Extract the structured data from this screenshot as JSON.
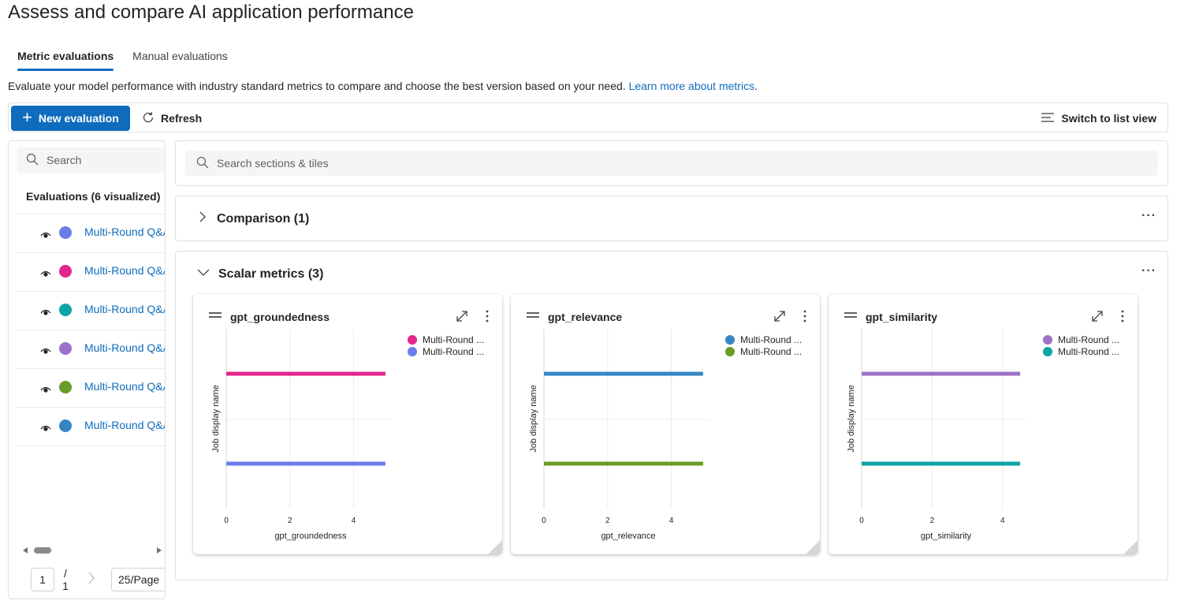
{
  "page": {
    "title": "Assess and compare AI application performance"
  },
  "tabs": [
    {
      "label": "Metric evaluations",
      "active": true
    },
    {
      "label": "Manual evaluations",
      "active": false
    }
  ],
  "description": {
    "text": "Evaluate your model performance with industry standard metrics to compare and choose the best version based on your need.",
    "link": "Learn more about metrics",
    "suffix": "."
  },
  "toolbar": {
    "new_label": "New evaluation",
    "refresh_label": "Refresh",
    "listview_label": "Switch to list view"
  },
  "left": {
    "search_placeholder": "Search",
    "heading": "Evaluations (6 visualized)",
    "items": [
      {
        "label": "Multi-Round Q&A",
        "color": "#6b7de8"
      },
      {
        "label": "Multi-Round Q&A",
        "color": "#e3258e"
      },
      {
        "label": "Multi-Round Q&A",
        "color": "#0ea3a5"
      },
      {
        "label": "Multi-Round Q&A",
        "color": "#9b72c8"
      },
      {
        "label": "Multi-Round Q&A",
        "color": "#6a9b26"
      },
      {
        "label": "Multi-Round Q&A",
        "color": "#3586c5"
      }
    ],
    "pager": {
      "page": "1",
      "of_slash": "/",
      "of_total": "1",
      "page_size": "25/Page"
    }
  },
  "right": {
    "search_placeholder": "Search sections & tiles",
    "sections": [
      {
        "title": "Comparison (1)",
        "expanded": false
      },
      {
        "title": "Scalar metrics (3)",
        "expanded": true
      }
    ]
  },
  "chart_data": [
    {
      "type": "bar",
      "orientation": "horizontal",
      "title": "gpt_groundedness",
      "xlabel": "gpt_groundedness",
      "ylabel": "Job display name",
      "xlim": [
        0,
        5.2
      ],
      "xticks": [
        0,
        2,
        4
      ],
      "grid": true,
      "legend_placement": "top-right",
      "series": [
        {
          "name": "Multi-Round ...",
          "color": "#e3258e",
          "value": 5
        },
        {
          "name": "Multi-Round ...",
          "color": "#6b7de8",
          "value": 5
        }
      ]
    },
    {
      "type": "bar",
      "orientation": "horizontal",
      "title": "gpt_relevance",
      "xlabel": "gpt_relevance",
      "ylabel": "Job display name",
      "xlim": [
        0,
        5.2
      ],
      "xticks": [
        0,
        2,
        4
      ],
      "grid": true,
      "legend_placement": "top-right",
      "series": [
        {
          "name": "Multi-Round ...",
          "color": "#3586c5",
          "value": 5
        },
        {
          "name": "Multi-Round ...",
          "color": "#6a9b26",
          "value": 5
        }
      ]
    },
    {
      "type": "bar",
      "orientation": "horizontal",
      "title": "gpt_similarity",
      "xlabel": "gpt_similarity",
      "ylabel": "Job display name",
      "xlim": [
        0,
        4.7
      ],
      "xticks": [
        0,
        2,
        4
      ],
      "grid": true,
      "legend_placement": "top-right",
      "series": [
        {
          "name": "Multi-Round ...",
          "color": "#9b72c8",
          "value": 4.5
        },
        {
          "name": "Multi-Round ...",
          "color": "#0ea3a5",
          "value": 4.5
        }
      ]
    }
  ]
}
